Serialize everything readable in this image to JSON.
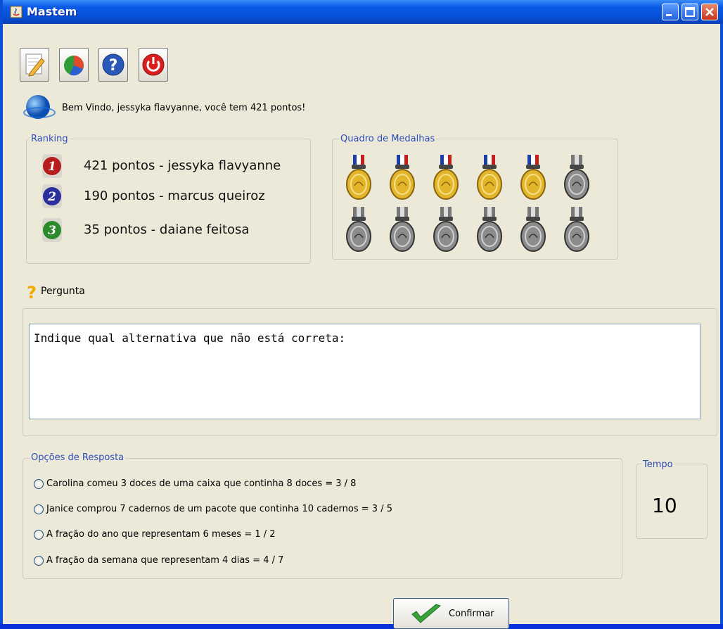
{
  "window": {
    "title": "Mastem"
  },
  "toolbar": [
    {
      "name": "edit-icon"
    },
    {
      "name": "chart-icon"
    },
    {
      "name": "help-icon"
    },
    {
      "name": "power-icon"
    }
  ],
  "welcome": "Bem Vindo, jessyka flavyanne, você tem 421 pontos!",
  "ranking": {
    "title": "Ranking",
    "items": [
      {
        "place": "1",
        "text": "421 pontos - jessyka flavyanne",
        "color": "#b81c1c"
      },
      {
        "place": "2",
        "text": "190 pontos - marcus queiroz",
        "color": "#2a2f9c"
      },
      {
        "place": "3",
        "text": "35 pontos - daiane feitosa",
        "color": "#2b8a2b"
      }
    ]
  },
  "medals": {
    "title": "Quadro de Medalhas",
    "earned": 5,
    "total": 12
  },
  "question": {
    "label": "Pergunta",
    "text": "Indique qual alternativa que não está correta:"
  },
  "options": {
    "title": "Opções de Resposta",
    "items": [
      "Carolina comeu 3 doces de uma caixa que continha 8 doces = 3 / 8",
      "Janice comprou 7 cadernos de um pacote que continha 10 cadernos = 3 / 5",
      "A fração do ano que representam 6 meses = 1 / 2",
      "A fração da semana que representam 4 dias = 4 / 7"
    ]
  },
  "timer": {
    "title": "Tempo",
    "value": "10"
  },
  "confirm": {
    "label": "Confirmar"
  }
}
